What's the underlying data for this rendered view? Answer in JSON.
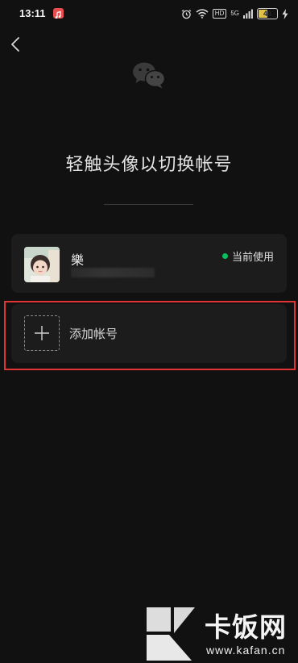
{
  "status_bar": {
    "time": "13:11",
    "network_badge": "HD",
    "signal_label": "5G",
    "battery_level": "44",
    "battery_percent": 44
  },
  "header": {
    "back_icon": "chevron-left-icon",
    "logo_icon": "wechat-logo-icon",
    "title": "轻触头像以切换帐号"
  },
  "accounts": [
    {
      "name": "樂",
      "status": "当前使用",
      "status_color": "#07c160"
    }
  ],
  "add_account": {
    "icon": "plus-icon",
    "label": "添加帐号"
  },
  "highlight_color": "#e03333",
  "watermark": {
    "brand": "卡饭网",
    "url": "www.kafan.cn"
  }
}
